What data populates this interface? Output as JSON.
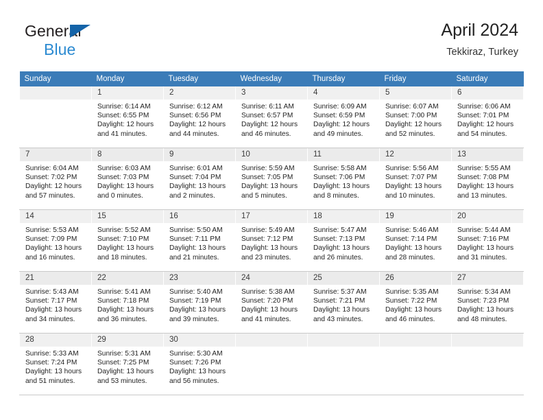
{
  "brand": {
    "line1": "General",
    "line2": "Blue",
    "flag_icon": "blue-triangle-flag-icon"
  },
  "header": {
    "title": "April 2024",
    "subtitle": "Tekkiraz, Turkey"
  },
  "colors": {
    "header_row_bg": "#3b7cb8",
    "header_row_text": "#ffffff",
    "daynum_bg": "#f0f0f0",
    "shaded_row_bg": "#ebebeb",
    "brand_blue": "#2b8ad1",
    "flag_blue": "#1463a8",
    "cell_border": "#c9c9c9"
  },
  "weekday_headers": [
    "Sunday",
    "Monday",
    "Tuesday",
    "Wednesday",
    "Thursday",
    "Friday",
    "Saturday"
  ],
  "weeks": [
    {
      "shaded": false,
      "days": [
        {
          "num": "",
          "lines": [
            "",
            "",
            "",
            ""
          ]
        },
        {
          "num": "1",
          "lines": [
            "Sunrise: 6:14 AM",
            "Sunset: 6:55 PM",
            "Daylight: 12 hours",
            "and 41 minutes."
          ]
        },
        {
          "num": "2",
          "lines": [
            "Sunrise: 6:12 AM",
            "Sunset: 6:56 PM",
            "Daylight: 12 hours",
            "and 44 minutes."
          ]
        },
        {
          "num": "3",
          "lines": [
            "Sunrise: 6:11 AM",
            "Sunset: 6:57 PM",
            "Daylight: 12 hours",
            "and 46 minutes."
          ]
        },
        {
          "num": "4",
          "lines": [
            "Sunrise: 6:09 AM",
            "Sunset: 6:59 PM",
            "Daylight: 12 hours",
            "and 49 minutes."
          ]
        },
        {
          "num": "5",
          "lines": [
            "Sunrise: 6:07 AM",
            "Sunset: 7:00 PM",
            "Daylight: 12 hours",
            "and 52 minutes."
          ]
        },
        {
          "num": "6",
          "lines": [
            "Sunrise: 6:06 AM",
            "Sunset: 7:01 PM",
            "Daylight: 12 hours",
            "and 54 minutes."
          ]
        }
      ]
    },
    {
      "shaded": true,
      "days": [
        {
          "num": "7",
          "lines": [
            "Sunrise: 6:04 AM",
            "Sunset: 7:02 PM",
            "Daylight: 12 hours",
            "and 57 minutes."
          ]
        },
        {
          "num": "8",
          "lines": [
            "Sunrise: 6:03 AM",
            "Sunset: 7:03 PM",
            "Daylight: 13 hours",
            "and 0 minutes."
          ]
        },
        {
          "num": "9",
          "lines": [
            "Sunrise: 6:01 AM",
            "Sunset: 7:04 PM",
            "Daylight: 13 hours",
            "and 2 minutes."
          ]
        },
        {
          "num": "10",
          "lines": [
            "Sunrise: 5:59 AM",
            "Sunset: 7:05 PM",
            "Daylight: 13 hours",
            "and 5 minutes."
          ]
        },
        {
          "num": "11",
          "lines": [
            "Sunrise: 5:58 AM",
            "Sunset: 7:06 PM",
            "Daylight: 13 hours",
            "and 8 minutes."
          ]
        },
        {
          "num": "12",
          "lines": [
            "Sunrise: 5:56 AM",
            "Sunset: 7:07 PM",
            "Daylight: 13 hours",
            "and 10 minutes."
          ]
        },
        {
          "num": "13",
          "lines": [
            "Sunrise: 5:55 AM",
            "Sunset: 7:08 PM",
            "Daylight: 13 hours",
            "and 13 minutes."
          ]
        }
      ]
    },
    {
      "shaded": false,
      "days": [
        {
          "num": "14",
          "lines": [
            "Sunrise: 5:53 AM",
            "Sunset: 7:09 PM",
            "Daylight: 13 hours",
            "and 16 minutes."
          ]
        },
        {
          "num": "15",
          "lines": [
            "Sunrise: 5:52 AM",
            "Sunset: 7:10 PM",
            "Daylight: 13 hours",
            "and 18 minutes."
          ]
        },
        {
          "num": "16",
          "lines": [
            "Sunrise: 5:50 AM",
            "Sunset: 7:11 PM",
            "Daylight: 13 hours",
            "and 21 minutes."
          ]
        },
        {
          "num": "17",
          "lines": [
            "Sunrise: 5:49 AM",
            "Sunset: 7:12 PM",
            "Daylight: 13 hours",
            "and 23 minutes."
          ]
        },
        {
          "num": "18",
          "lines": [
            "Sunrise: 5:47 AM",
            "Sunset: 7:13 PM",
            "Daylight: 13 hours",
            "and 26 minutes."
          ]
        },
        {
          "num": "19",
          "lines": [
            "Sunrise: 5:46 AM",
            "Sunset: 7:14 PM",
            "Daylight: 13 hours",
            "and 28 minutes."
          ]
        },
        {
          "num": "20",
          "lines": [
            "Sunrise: 5:44 AM",
            "Sunset: 7:16 PM",
            "Daylight: 13 hours",
            "and 31 minutes."
          ]
        }
      ]
    },
    {
      "shaded": true,
      "days": [
        {
          "num": "21",
          "lines": [
            "Sunrise: 5:43 AM",
            "Sunset: 7:17 PM",
            "Daylight: 13 hours",
            "and 34 minutes."
          ]
        },
        {
          "num": "22",
          "lines": [
            "Sunrise: 5:41 AM",
            "Sunset: 7:18 PM",
            "Daylight: 13 hours",
            "and 36 minutes."
          ]
        },
        {
          "num": "23",
          "lines": [
            "Sunrise: 5:40 AM",
            "Sunset: 7:19 PM",
            "Daylight: 13 hours",
            "and 39 minutes."
          ]
        },
        {
          "num": "24",
          "lines": [
            "Sunrise: 5:38 AM",
            "Sunset: 7:20 PM",
            "Daylight: 13 hours",
            "and 41 minutes."
          ]
        },
        {
          "num": "25",
          "lines": [
            "Sunrise: 5:37 AM",
            "Sunset: 7:21 PM",
            "Daylight: 13 hours",
            "and 43 minutes."
          ]
        },
        {
          "num": "26",
          "lines": [
            "Sunrise: 5:35 AM",
            "Sunset: 7:22 PM",
            "Daylight: 13 hours",
            "and 46 minutes."
          ]
        },
        {
          "num": "27",
          "lines": [
            "Sunrise: 5:34 AM",
            "Sunset: 7:23 PM",
            "Daylight: 13 hours",
            "and 48 minutes."
          ]
        }
      ]
    },
    {
      "shaded": false,
      "days": [
        {
          "num": "28",
          "lines": [
            "Sunrise: 5:33 AM",
            "Sunset: 7:24 PM",
            "Daylight: 13 hours",
            "and 51 minutes."
          ]
        },
        {
          "num": "29",
          "lines": [
            "Sunrise: 5:31 AM",
            "Sunset: 7:25 PM",
            "Daylight: 13 hours",
            "and 53 minutes."
          ]
        },
        {
          "num": "30",
          "lines": [
            "Sunrise: 5:30 AM",
            "Sunset: 7:26 PM",
            "Daylight: 13 hours",
            "and 56 minutes."
          ]
        },
        {
          "num": "",
          "lines": [
            "",
            "",
            "",
            ""
          ]
        },
        {
          "num": "",
          "lines": [
            "",
            "",
            "",
            ""
          ]
        },
        {
          "num": "",
          "lines": [
            "",
            "",
            "",
            ""
          ]
        },
        {
          "num": "",
          "lines": [
            "",
            "",
            "",
            ""
          ]
        }
      ]
    }
  ]
}
